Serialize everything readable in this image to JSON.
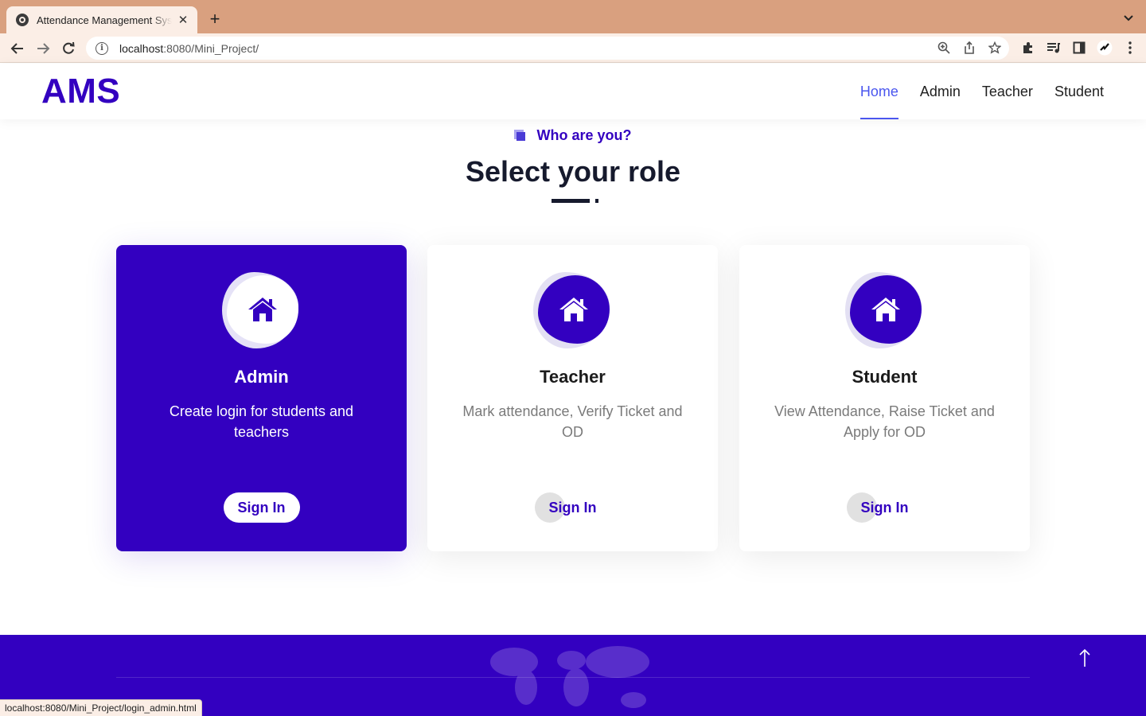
{
  "browser": {
    "tab_title": "Attendance Management System",
    "url_host": "localhost",
    "url_rest": ":8080/Mini_Project/",
    "status_url": "localhost:8080/Mini_Project/login_admin.html"
  },
  "site": {
    "logo": "AMS",
    "nav": [
      {
        "label": "Home",
        "active": true
      },
      {
        "label": "Admin",
        "active": false
      },
      {
        "label": "Teacher",
        "active": false
      },
      {
        "label": "Student",
        "active": false
      }
    ]
  },
  "section": {
    "subtitle": "Who are you?",
    "heading": "Select your role"
  },
  "cards": [
    {
      "title": "Admin",
      "description": "Create login for students and teachers",
      "button": "Sign In",
      "icon": "home-icon",
      "active": true
    },
    {
      "title": "Teacher",
      "description": "Mark attendance, Verify Ticket and OD",
      "button": "Sign In",
      "icon": "home-icon",
      "active": false
    },
    {
      "title": "Student",
      "description": "View Attendance, Raise Ticket and Apply for OD",
      "button": "Sign In",
      "icon": "home-icon",
      "active": false
    }
  ],
  "colors": {
    "brand": "#3300c0",
    "nav_active": "#4a56ee",
    "browser_frame": "#d9a07f"
  },
  "icons": {
    "back_to_top": "arrow-up-icon"
  }
}
